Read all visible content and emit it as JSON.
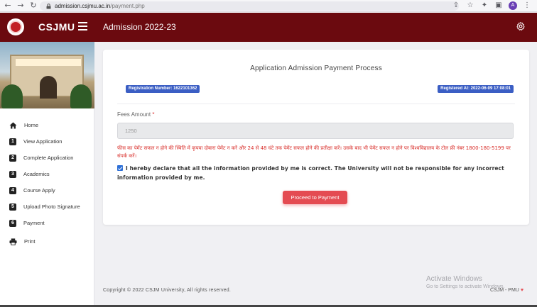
{
  "browser": {
    "url_host": "admission.csjmu.ac.in",
    "url_path": "/payment.php",
    "profile_initial": "A"
  },
  "header": {
    "brand": "CSJMU",
    "title": "Admission 2022-23"
  },
  "sidebar": {
    "items": [
      {
        "num": "",
        "label": "Home",
        "icon": "home-icon"
      },
      {
        "num": "1",
        "label": "View Application"
      },
      {
        "num": "2",
        "label": "Complete Application"
      },
      {
        "num": "3",
        "label": "Academics"
      },
      {
        "num": "4",
        "label": "Course Apply"
      },
      {
        "num": "5",
        "label": "Upload Photo Signature"
      },
      {
        "num": "6",
        "label": "Payment"
      },
      {
        "num": "",
        "label": "Print",
        "icon": "printer-icon"
      }
    ]
  },
  "payment": {
    "title": "Application Admission Payment Process",
    "registration_number": "Registration Number: 1622101362",
    "registered_at": "Registered At: 2022-06-09 17:08:01",
    "fees_label": "Fees Amount",
    "fees_required_mark": "*",
    "fees_value": "1250",
    "hindi_notice": "फीस का पेमेंट सफल न होने की स्थिति में कृपया दोबारा पेमेंट न करें और 24 से 48 घंटे तक पेमेंट सफल होने की प्रतीक्षा करें। उसके बाद भी पेमेंट सफल न होने पर विश्वविद्यालय के टोल फ्री नंबर 1800-180-5199 पर संपर्क करें।",
    "declaration": "I hereby declare that all the information provided by me is correct. The University will not be responsible for any incorrect information provided by me.",
    "declaration_checked": true,
    "proceed_label": "Proceed to Payment"
  },
  "footer": {
    "copyright": "Copyright © 2022 CSJM University, All rights reserved.",
    "credit": "CSJM - PMU",
    "heart": "♥"
  },
  "watermark": {
    "line1": "Activate Windows",
    "line2": "Go to Settings to activate Windows."
  },
  "colors": {
    "header_bg": "#6b0a0f",
    "badge_bg": "#3b5ec4",
    "button_bg": "#e44b52",
    "notice_text": "#d9302c"
  }
}
